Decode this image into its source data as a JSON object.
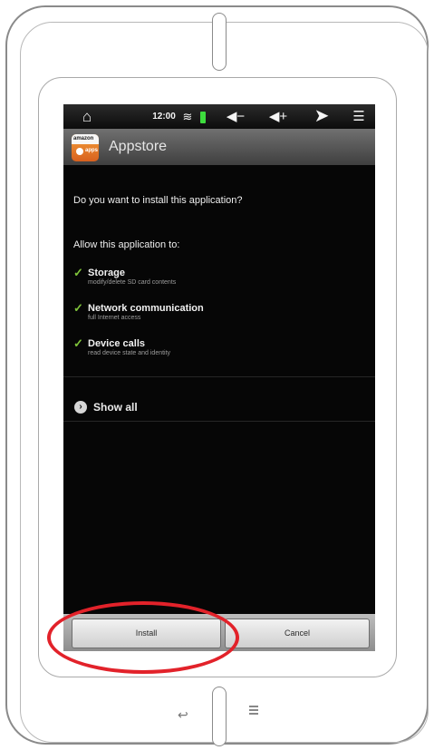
{
  "status_bar": {
    "home_icon": "home-icon",
    "time": "12:00",
    "wifi_icon": "wifi-icon",
    "battery_icon": "battery-icon",
    "volume_down_icon": "volume-down-icon",
    "volume_up_icon": "volume-up-icon",
    "back_icon": "back-icon",
    "menu_icon": "menu-icon",
    "battery_color": "#3ddc3d"
  },
  "title_bar": {
    "app_icon": "appstore-icon",
    "icon_brand": "amazon",
    "icon_badge": "apps",
    "title": "Appstore"
  },
  "dialog": {
    "question": "Do you want to install this application?",
    "allow_heading": "Allow this application to:",
    "permissions": [
      {
        "title": "Storage",
        "description": "modify/delete SD card contents"
      },
      {
        "title": "Network communication",
        "description": "full Internet access"
      },
      {
        "title": "Device calls",
        "description": "read device state and identity"
      }
    ],
    "show_all": "Show all"
  },
  "buttons": {
    "install": "Install",
    "cancel": "Cancel"
  },
  "annotation": {
    "highlight_color": "#e2222a",
    "highlight_target": "install-button"
  },
  "device_nav": {
    "back_icon": "hardware-back-icon",
    "menu_icon": "hardware-menu-icon"
  }
}
